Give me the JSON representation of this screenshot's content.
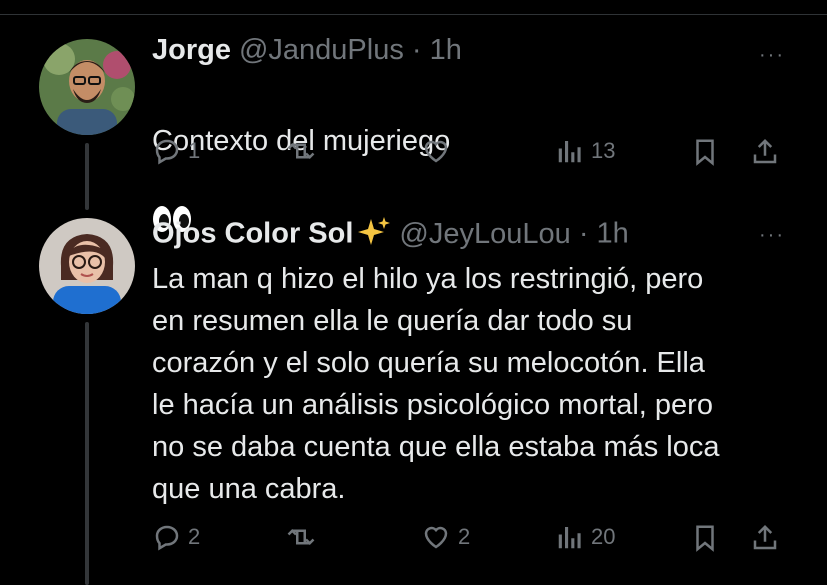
{
  "tweets": [
    {
      "name": "Jorge",
      "handle": "@JanduPlus",
      "separator": "·",
      "time": "1h",
      "text": "Contexto del mujeriego",
      "emoji": "eyes-emoji",
      "actions": {
        "replies": "1",
        "retweets": "",
        "likes": "",
        "views": "13"
      }
    },
    {
      "name": "Ojos Color Sol",
      "name_emoji": "sparkles-emoji",
      "handle": "@JeyLouLou",
      "separator": "·",
      "time": "1h",
      "text": "La man q hizo el hilo ya los restringió, pero\nen resumen ella le quería dar todo su\ncorazón y el solo quería su melocotón. Ella\nle hacía un análisis psicológico mortal, pero\nno se daba cuenta que ella estaba más loca\nque una cabra.",
      "actions": {
        "replies": "2",
        "retweets": "",
        "likes": "2",
        "views": "20"
      }
    }
  ],
  "more_label": "···",
  "colors": {
    "background": "#000000",
    "text": "#e7e9ea",
    "muted": "#71767b",
    "thread_line": "#333639"
  }
}
